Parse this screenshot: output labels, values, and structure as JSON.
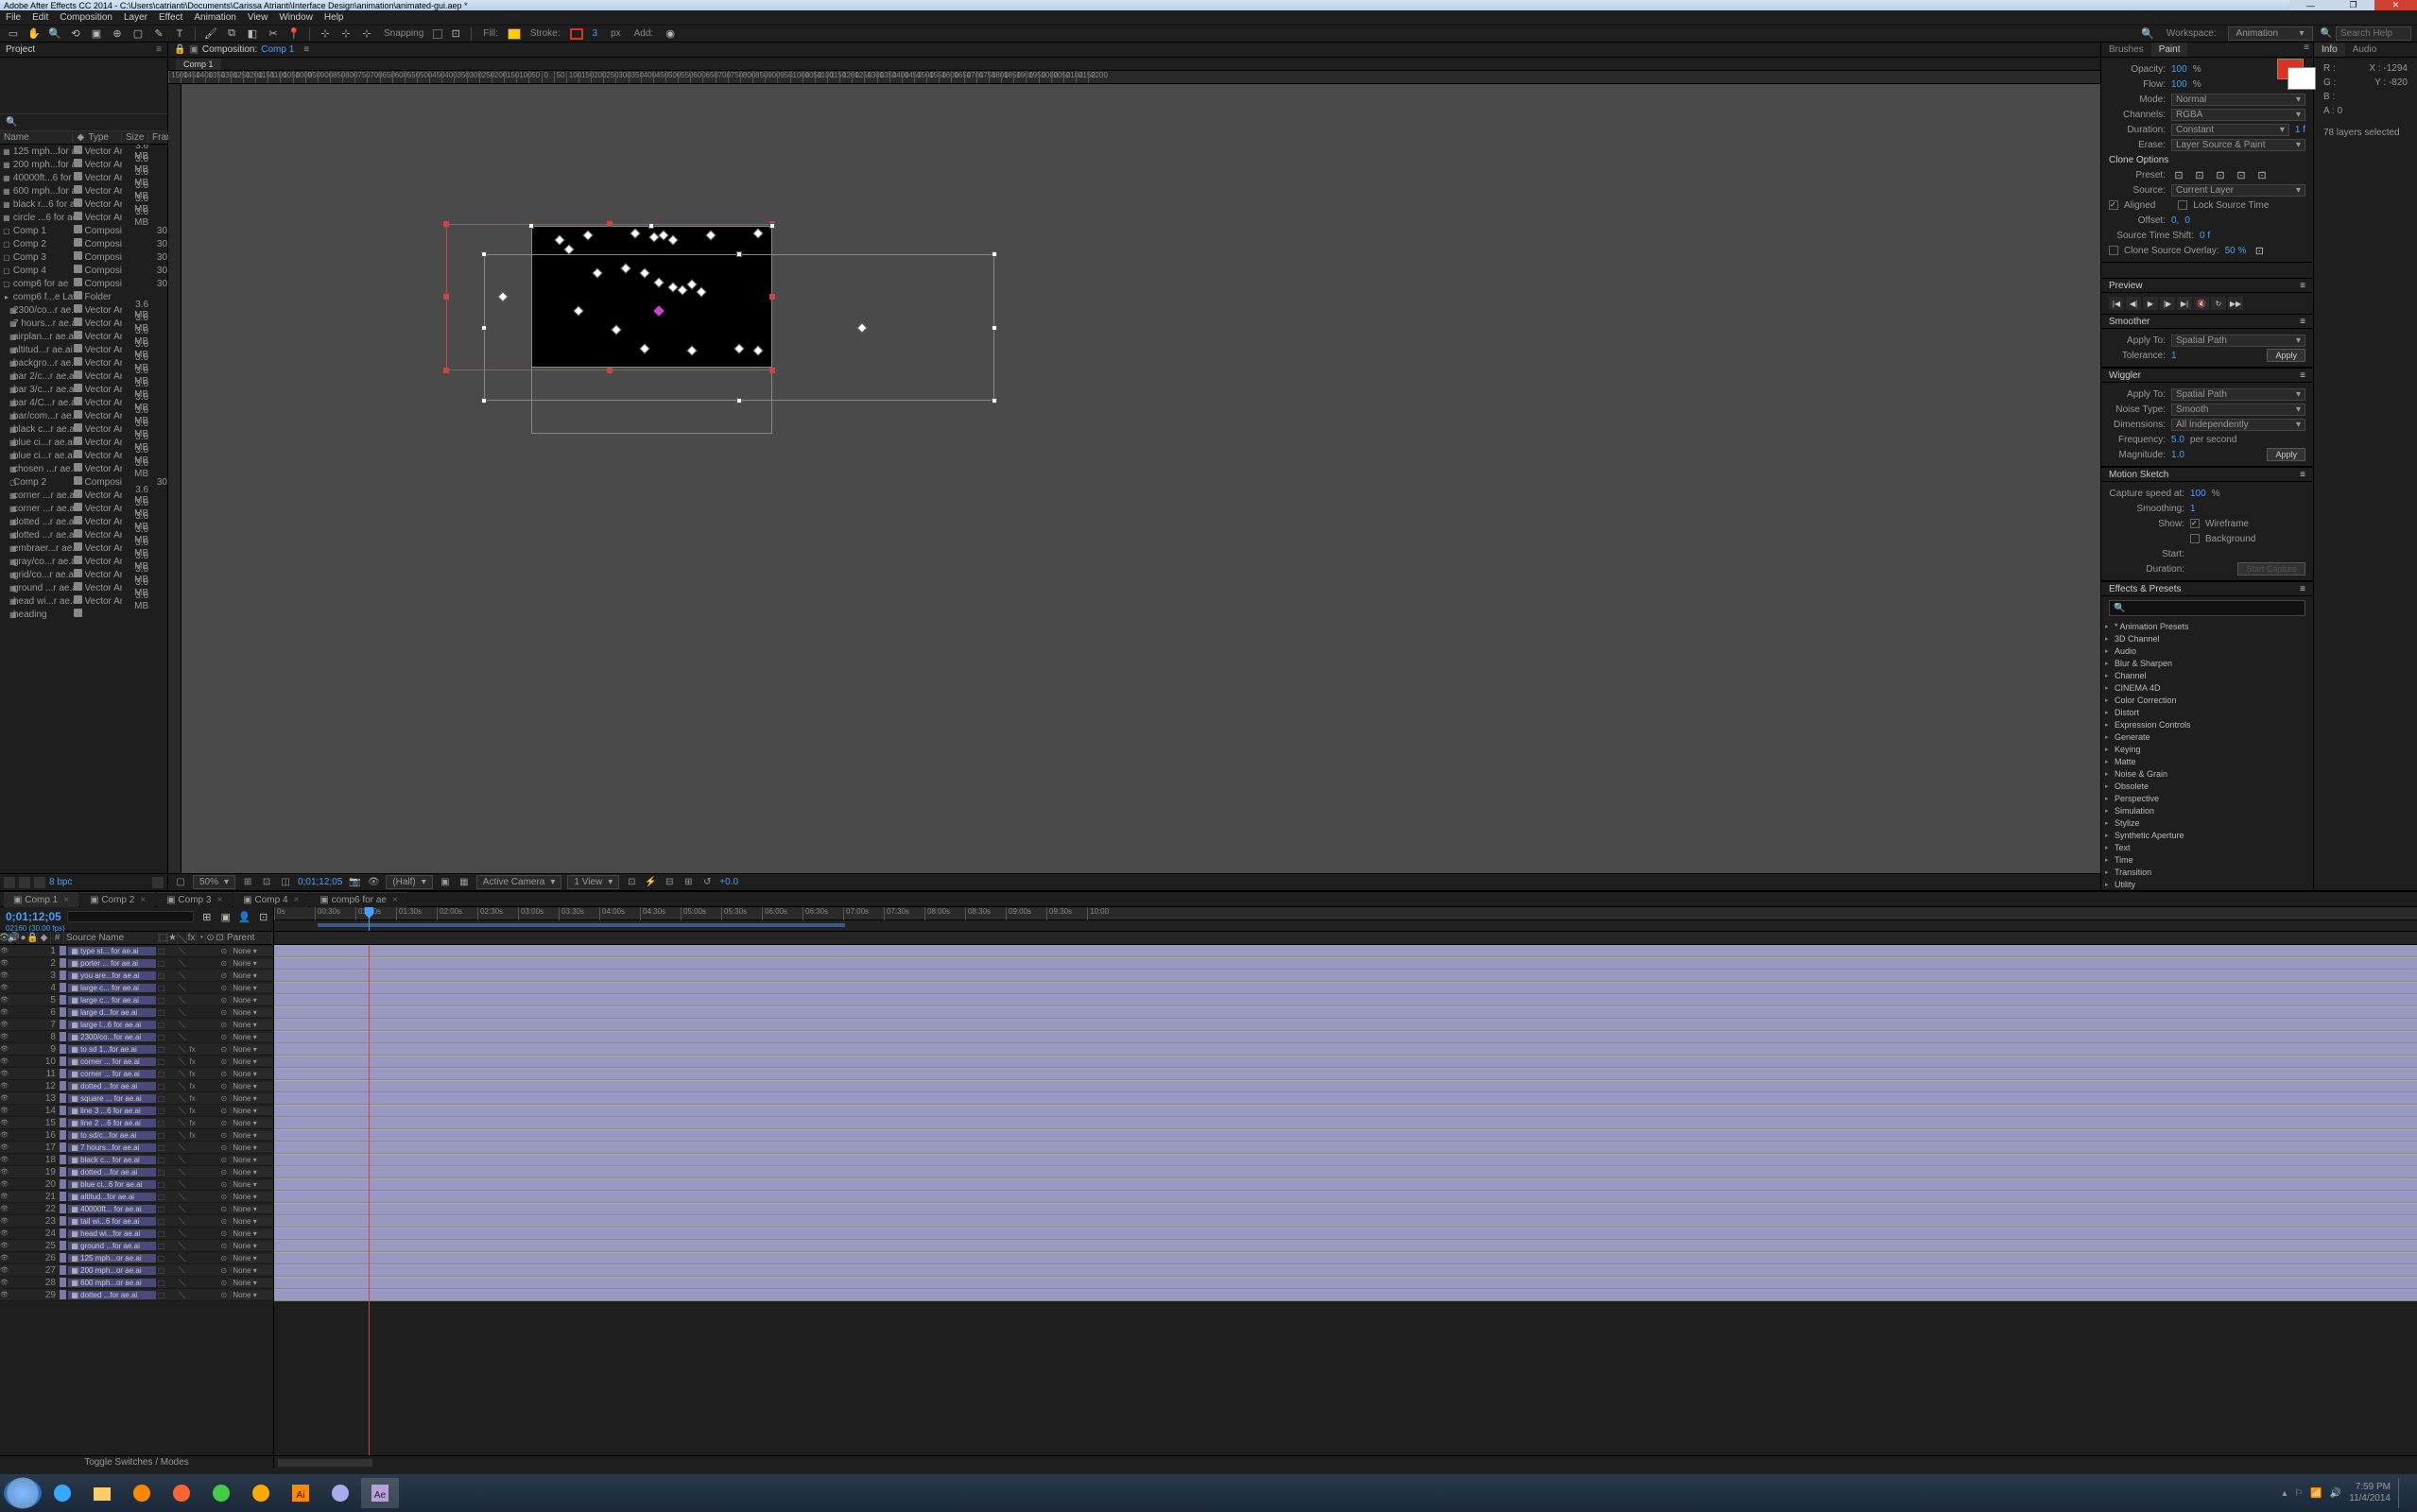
{
  "title": "Adobe After Effects CC 2014 - C:\\Users\\catrianti\\Documents\\Carissa Atrianti\\Interface Design\\animation\\animated-gui.aep *",
  "menu": [
    "File",
    "Edit",
    "Composition",
    "Layer",
    "Effect",
    "Animation",
    "View",
    "Window",
    "Help"
  ],
  "toolbar": {
    "snapping": "Snapping",
    "fill": "Fill:",
    "stroke": "Stroke:",
    "stroke_px": "px",
    "stroke_val": "3",
    "add": "Add:",
    "workspace_lbl": "Workspace:",
    "workspace": "Animation",
    "search_ph": "Search Help"
  },
  "project": {
    "tab": "Project",
    "cols": {
      "name": "Name",
      "type": "Type",
      "size": "Size",
      "frame": "Fram"
    },
    "footer_bpc": "8 bpc",
    "items": [
      {
        "i": "▦",
        "n": "125 mph...for ae.ai",
        "t": "Vector Art",
        "s": "3.6 MB"
      },
      {
        "i": "▦",
        "n": "200 mph...for ae.ai",
        "t": "Vector Art",
        "s": "3.6 MB"
      },
      {
        "i": "▦",
        "n": "40000ft...6 for ae.ai",
        "t": "Vector Art",
        "s": "3.6 MB"
      },
      {
        "i": "▦",
        "n": "600 mph...for ae.ai",
        "t": "Vector Art",
        "s": "3.6 MB"
      },
      {
        "i": "▦",
        "n": "black r...6 for ae.ai",
        "t": "Vector Art",
        "s": "3.6 MB"
      },
      {
        "i": "▦",
        "n": "circle ...6 for ae.ai",
        "t": "Vector Art",
        "s": "3.6 MB"
      },
      {
        "i": "▢",
        "n": "Comp 1",
        "t": "Composition",
        "s": "",
        "f": "30"
      },
      {
        "i": "▢",
        "n": "Comp 2",
        "t": "Composition",
        "s": "",
        "f": "30"
      },
      {
        "i": "▢",
        "n": "Comp 3",
        "t": "Composition",
        "s": "",
        "f": "30"
      },
      {
        "i": "▢",
        "n": "Comp 4",
        "t": "Composition",
        "s": "",
        "f": "30"
      },
      {
        "i": "▢",
        "n": "comp6 for ae",
        "t": "Composition",
        "s": "",
        "f": "30"
      },
      {
        "i": "▸",
        "n": "comp6 f...e Layers",
        "t": "Folder",
        "s": ""
      },
      {
        "i": "▦",
        "n": "2300/co...r ae.ai",
        "t": "Vector Art",
        "s": "3.6 MB",
        "ind": 1
      },
      {
        "i": "▦",
        "n": "7 hours...r ae.ai",
        "t": "Vector Art",
        "s": "3.6 MB",
        "ind": 1
      },
      {
        "i": "▦",
        "n": "airplan...r ae.ai",
        "t": "Vector Art",
        "s": "3.6 MB",
        "ind": 1
      },
      {
        "i": "▦",
        "n": "altitud...r ae.ai",
        "t": "Vector Art",
        "s": "3.6 MB",
        "ind": 1
      },
      {
        "i": "▦",
        "n": "backgro...r ae.ai",
        "t": "Vector Art",
        "s": "3.6 MB",
        "ind": 1
      },
      {
        "i": "▦",
        "n": "bar 2/c...r ae.ai",
        "t": "Vector Art",
        "s": "3.6 MB",
        "ind": 1
      },
      {
        "i": "▦",
        "n": "bar 3/c...r ae.ai",
        "t": "Vector Art",
        "s": "3.6 MB",
        "ind": 1
      },
      {
        "i": "▦",
        "n": "bar 4/C...r ae.ai",
        "t": "Vector Art",
        "s": "3.6 MB",
        "ind": 1
      },
      {
        "i": "▦",
        "n": "bar/com...r ae.ai",
        "t": "Vector Art",
        "s": "3.6 MB",
        "ind": 1
      },
      {
        "i": "▦",
        "n": "black c...r ae.ai",
        "t": "Vector Art",
        "s": "3.6 MB",
        "ind": 1
      },
      {
        "i": "▦",
        "n": "blue ci...r ae.ai",
        "t": "Vector Art",
        "s": "3.6 MB",
        "ind": 1
      },
      {
        "i": "▦",
        "n": "blue ci...r ae.ai",
        "t": "Vector Art",
        "s": "3.6 MB",
        "ind": 1
      },
      {
        "i": "▦",
        "n": "chosen ...r ae.ai",
        "t": "Vector Art",
        "s": "3.6 MB",
        "ind": 1
      },
      {
        "i": "▢",
        "n": "Comp 2",
        "t": "Composition",
        "s": "",
        "f": "30",
        "ind": 1
      },
      {
        "i": "▦",
        "n": "corner ...r ae.ai",
        "t": "Vector Art",
        "s": "3.6 MB",
        "ind": 1
      },
      {
        "i": "▦",
        "n": "corner ...r ae.ai",
        "t": "Vector Art",
        "s": "3.6 MB",
        "ind": 1
      },
      {
        "i": "▦",
        "n": "dotted ...r ae.ai",
        "t": "Vector Art",
        "s": "3.6 MB",
        "ind": 1
      },
      {
        "i": "▦",
        "n": "dotted ...r ae.ai",
        "t": "Vector Art",
        "s": "3.6 MB",
        "ind": 1
      },
      {
        "i": "▦",
        "n": "embraer...r ae.ai",
        "t": "Vector Art",
        "s": "3.6 MB",
        "ind": 1
      },
      {
        "i": "▦",
        "n": "gray/co...r ae.ai",
        "t": "Vector Art",
        "s": "3.6 MB",
        "ind": 1
      },
      {
        "i": "▦",
        "n": "grid/co...r ae.ai",
        "t": "Vector Art",
        "s": "3.6 MB",
        "ind": 1
      },
      {
        "i": "▦",
        "n": "ground ...r ae.ai",
        "t": "Vector Art",
        "s": "3.6 MB",
        "ind": 1
      },
      {
        "i": "▦",
        "n": "head wi...r ae.ai",
        "t": "Vector Art",
        "s": "3.6 MB",
        "ind": 1
      },
      {
        "i": "▦",
        "n": "heading",
        "t": "",
        "s": "",
        "ind": 1
      }
    ]
  },
  "comp": {
    "label": "Composition:",
    "name": "Comp 1",
    "subtab": "Comp 1",
    "ruler_start": -1500,
    "ruler_step": 50,
    "footer": {
      "mag": "50%",
      "tc": "0;01;12;05",
      "res": "(Half)",
      "cam": "Active Camera",
      "view": "1 View",
      "exp": "+0.0"
    }
  },
  "paint": {
    "tabs": [
      "Brushes",
      "Paint"
    ],
    "opacity_lbl": "Opacity:",
    "opacity": "100",
    "pct": "%",
    "flow_lbl": "Flow:",
    "flow": "100",
    "mode_lbl": "Mode:",
    "mode": "Normal",
    "channels_lbl": "Channels:",
    "channels": "RGBA",
    "duration_lbl": "Duration:",
    "duration": "Constant",
    "duration_f": "1 f",
    "erase_lbl": "Erase:",
    "erase": "Layer Source & Paint",
    "clone_hdr": "Clone Options",
    "preset_lbl": "Preset:",
    "source_lbl": "Source:",
    "source": "Current Layer",
    "aligned": "Aligned",
    "locktime": "Lock Source Time",
    "offset_lbl": "Offset:",
    "offset_x": "0,",
    "offset_y": "0",
    "timeshift_lbl": "Source Time Shift:",
    "timeshift": "0 f",
    "overlay": "Clone Source Overlay:",
    "overlay_v": "50 %"
  },
  "info": {
    "tabs": [
      "Info",
      "Audio"
    ],
    "r": "R :",
    "g": "G :",
    "b": "B :",
    "a": "A : 0",
    "x": "X : -1294",
    "y": "Y : -820",
    "status": "78 layers selected"
  },
  "preview": {
    "hdr": "Preview"
  },
  "smoother": {
    "hdr": "Smoother",
    "apply_lbl": "Apply To:",
    "apply": "Spatial Path",
    "tol_lbl": "Tolerance:",
    "tol": "1",
    "apply_btn": "Apply"
  },
  "wiggler": {
    "hdr": "Wiggler",
    "apply_lbl": "Apply To:",
    "apply": "Spatial Path",
    "noise_lbl": "Noise Type:",
    "noise": "Smooth",
    "dim_lbl": "Dimensions:",
    "dim": "All Independently",
    "freq_lbl": "Frequency:",
    "freq": "5.0",
    "freq_u": "per second",
    "mag_lbl": "Magnitude:",
    "mag": "1.0",
    "apply_btn": "Apply"
  },
  "sketch": {
    "hdr": "Motion Sketch",
    "speed_lbl": "Capture speed at:",
    "speed": "100",
    "pct": "%",
    "smooth_lbl": "Smoothing:",
    "smooth": "1",
    "show_lbl": "Show:",
    "wf": "Wireframe",
    "bg": "Background",
    "start_lbl": "Start:",
    "dur_lbl": "Duration:",
    "btn": "Start Capture"
  },
  "effects": {
    "hdr": "Effects & Presets",
    "items": [
      "* Animation Presets",
      "3D Channel",
      "Audio",
      "Blur & Sharpen",
      "Channel",
      "CINEMA 4D",
      "Color Correction",
      "Distort",
      "Expression Controls",
      "Generate",
      "Keying",
      "Matte",
      "Noise & Grain",
      "Obsolete",
      "Perspective",
      "Simulation",
      "Stylize",
      "Synthetic Aperture",
      "Text",
      "Time",
      "Transition",
      "Utility"
    ]
  },
  "timeline": {
    "tabs": [
      "Comp 1",
      "Comp 2",
      "Comp 3",
      "Comp 4",
      "comp6 for ae"
    ],
    "tc": "0;01;12;05",
    "tc2": "02160 (30.00 fps)",
    "cols": {
      "src": "Source Name",
      "parent": "Parent"
    },
    "none": "None",
    "ruler": [
      "0s",
      "00:30s",
      "01:00s",
      "01:30s",
      "02:00s",
      "02:30s",
      "03:00s",
      "03:30s",
      "04:00s",
      "04:30s",
      "05:00s",
      "05:30s",
      "06:00s",
      "06:30s",
      "07:00s",
      "07:30s",
      "08:00s",
      "08:30s",
      "09:00s",
      "09:30s",
      "10:00"
    ],
    "foot": "Toggle Switches / Modes",
    "layers": [
      {
        "n": 1,
        "nm": "type st... for ae.ai"
      },
      {
        "n": 2,
        "nm": "porter ... for ae.ai"
      },
      {
        "n": 3,
        "nm": "you are...for ae.ai"
      },
      {
        "n": 4,
        "nm": "large c... for ae.ai"
      },
      {
        "n": 5,
        "nm": "large c... for ae.ai"
      },
      {
        "n": 6,
        "nm": "large d...for ae.ai"
      },
      {
        "n": 7,
        "nm": "large l...6 for ae.ai"
      },
      {
        "n": 8,
        "nm": "2300/co...for ae.ai"
      },
      {
        "n": 9,
        "nm": "to sd 1...for ae.ai"
      },
      {
        "n": 10,
        "nm": "corner ... for ae.ai"
      },
      {
        "n": 11,
        "nm": "corner ... for ae.ai"
      },
      {
        "n": 12,
        "nm": "dotted ...for ae.ai"
      },
      {
        "n": 13,
        "nm": "square ... for ae.ai"
      },
      {
        "n": 14,
        "nm": "line 3 ...6 for ae.ai"
      },
      {
        "n": 15,
        "nm": "line 2 ...6 for ae.ai"
      },
      {
        "n": 16,
        "nm": "to sd/c...for ae.ai"
      },
      {
        "n": 17,
        "nm": "7 hours...for ae.ai"
      },
      {
        "n": 18,
        "nm": "black c... for ae.ai"
      },
      {
        "n": 19,
        "nm": "dotted ...for ae.ai"
      },
      {
        "n": 20,
        "nm": "blue ci...6 for ae.ai"
      },
      {
        "n": 21,
        "nm": "altitud...for ae.ai"
      },
      {
        "n": 22,
        "nm": "40000ft... for ae.ai"
      },
      {
        "n": 23,
        "nm": "tail wi...6 for ae.ai"
      },
      {
        "n": 24,
        "nm": "head wi...for ae.ai"
      },
      {
        "n": 25,
        "nm": "ground ...for ae.ai"
      },
      {
        "n": 26,
        "nm": "125 mph...or ae.ai"
      },
      {
        "n": 27,
        "nm": "200 mph...or ae.ai"
      },
      {
        "n": 28,
        "nm": "600 mph...or ae.ai"
      },
      {
        "n": 29,
        "nm": "dotted ...for ae.ai"
      }
    ]
  },
  "taskbar": {
    "time": "7:59 PM",
    "date": "11/4/2014"
  }
}
